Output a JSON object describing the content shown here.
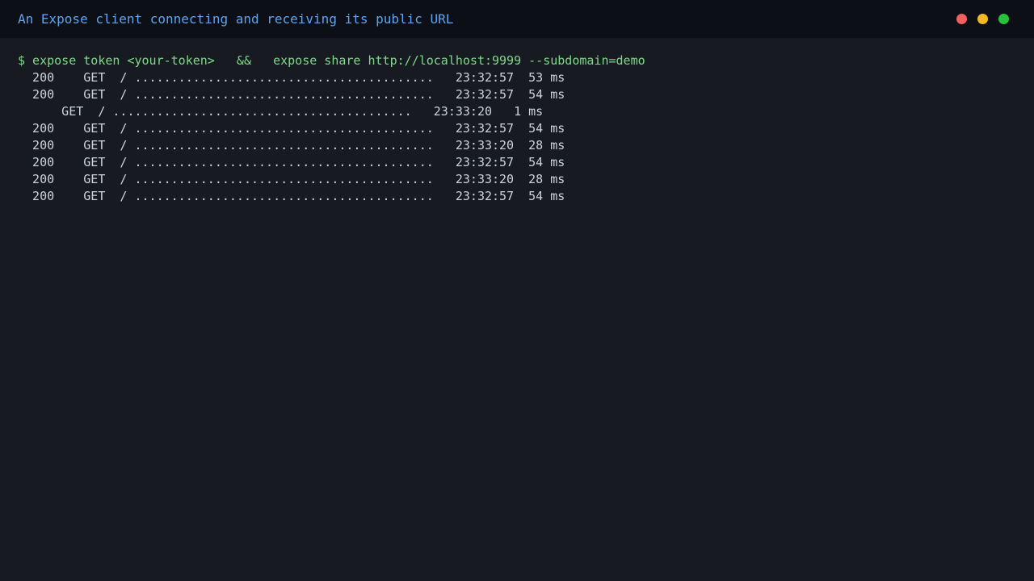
{
  "window": {
    "title": "An Expose client connecting and receiving its public URL",
    "controls": {
      "close_color": "#f06060",
      "minimize_color": "#f4b823",
      "maximize_color": "#27c23b"
    }
  },
  "terminal": {
    "command": "$ expose token <your-token>   &&   expose share http://localhost:9999 --subdomain=demo",
    "logs": [
      "  200    GET  / .........................................   23:32:57  53 ms",
      "  200    GET  / .........................................   23:32:57  54 ms",
      "      GET  / .........................................   23:33:20   1 ms",
      "  200    GET  / .........................................   23:32:57  54 ms",
      "  200    GET  / .........................................   23:33:20  28 ms",
      "  200    GET  / .........................................   23:32:57  54 ms",
      "  200    GET  / .........................................   23:33:20  28 ms",
      "  200    GET  / .........................................   23:32:57  54 ms"
    ]
  }
}
